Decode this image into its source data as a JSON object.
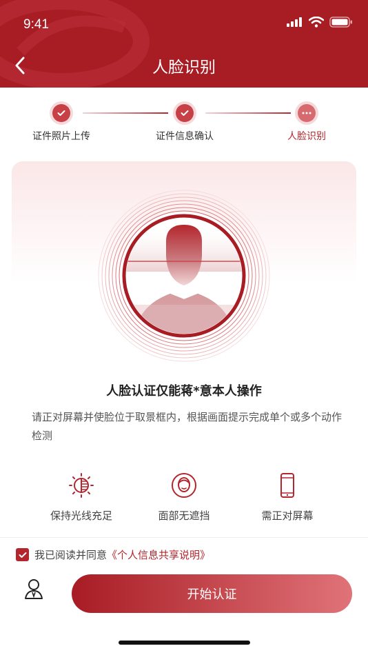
{
  "status_bar": {
    "time": "9:41"
  },
  "header": {
    "title": "人脸识别",
    "back_icon": "chevron-left-icon"
  },
  "stepper": {
    "steps": [
      {
        "label": "证件照片上传",
        "state": "done"
      },
      {
        "label": "证件信息确认",
        "state": "done"
      },
      {
        "label": "人脸识别",
        "state": "active"
      }
    ]
  },
  "notice": {
    "title": "人脸认证仅能蒋*意本人操作",
    "description": "请正对屏幕并使脸位于取景框内，根据画面提示完成单个或多个动作检测"
  },
  "tips": [
    {
      "label": "保持光线充足",
      "icon": "light-bulb-icon"
    },
    {
      "label": "面部无遮挡",
      "icon": "face-icon"
    },
    {
      "label": "需正对屏幕",
      "icon": "phone-icon"
    }
  ],
  "agreement": {
    "checked": true,
    "text": "我已阅读并同意",
    "link": "《个人信息共享说明》"
  },
  "actions": {
    "start_label": "开始认证"
  },
  "colors": {
    "brand": "#a81c24",
    "accent": "#b3262d",
    "button_end": "#e07378"
  }
}
